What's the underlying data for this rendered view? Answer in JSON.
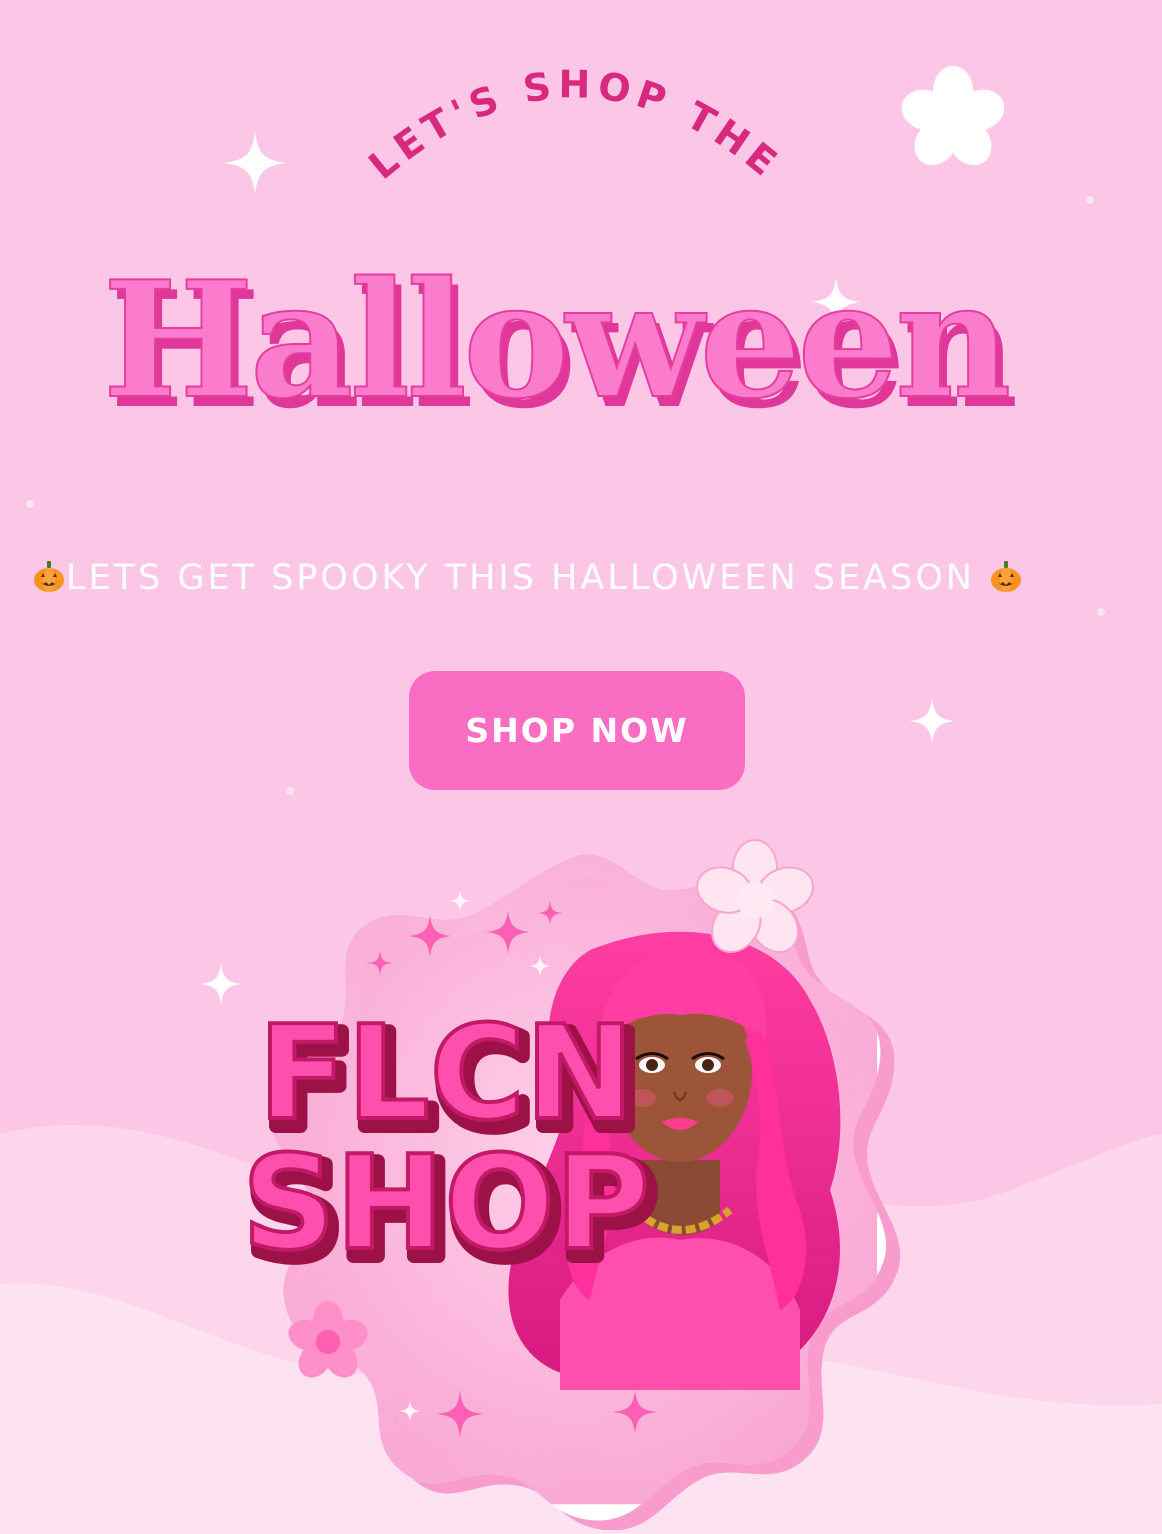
{
  "hero": {
    "eyebrow": "LET'S SHOP THE",
    "title": "Halloween"
  },
  "tagline": {
    "text": "LETS GET SPOOKY THIS HALLOWEEN SEASON",
    "emoji_icon": "jack-o-lantern-icon"
  },
  "cta": {
    "label": "SHOP NOW"
  },
  "logo": {
    "line1": "FLCN",
    "line2": "SHOP"
  },
  "colors": {
    "background": "#fcc7e6",
    "accent": "#f96ec3",
    "deep_pink": "#d9287f",
    "white": "#ffffff"
  }
}
